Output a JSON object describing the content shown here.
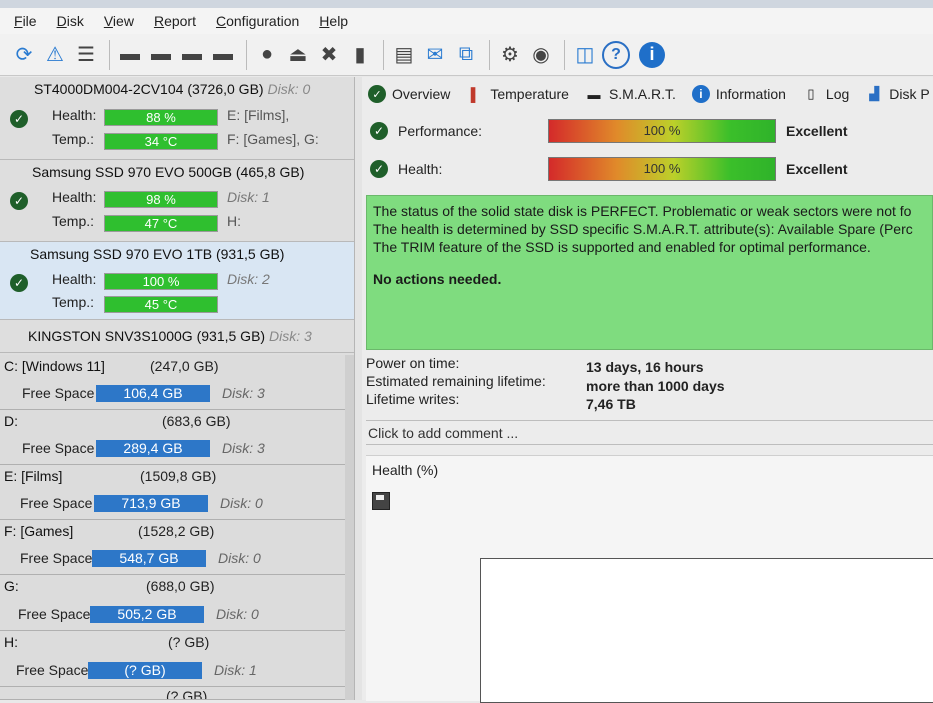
{
  "menu": [
    "File",
    "Disk",
    "View",
    "Report",
    "Configuration",
    "Help"
  ],
  "toolbar": {
    "icons": [
      "refresh-icon",
      "warning-refresh-icon",
      "list-icon",
      "hdd-icon",
      "hdd-clock-icon",
      "hdd-check-icon",
      "hdd-tool-icon",
      "disk-icon",
      "eject-icon",
      "tools-icon",
      "export-icon",
      "report-icon",
      "mail-icon",
      "network-icon",
      "settings-icon",
      "speaker-icon",
      "camera-icon",
      "help-icon",
      "info-icon"
    ],
    "help": "?",
    "info": "i"
  },
  "disks": [
    {
      "title": "ST4000DM004-2CV104",
      "size": "(3726,0 GB)",
      "disk": "Disk: 0",
      "health": "88 %",
      "temp": "34 °C",
      "side1": "E: [Films],",
      "side2": "F: [Games], G:"
    },
    {
      "title": "Samsung SSD 970 EVO 500GB",
      "size": "(465,8 GB)",
      "disk": "",
      "health": "98 %",
      "temp": "47 °C",
      "side1": "Disk: 1",
      "side2": "H:"
    },
    {
      "title": "Samsung SSD 970 EVO 1TB",
      "size": "(931,5 GB)",
      "disk": "",
      "health": "100 %",
      "temp": "45 °C",
      "side1": "Disk: 2",
      "side2": ""
    },
    {
      "title": "KINGSTON SNV3S1000G",
      "size": "(931,5 GB)",
      "disk": "Disk: 3"
    }
  ],
  "labels": {
    "health": "Health:",
    "temp": "Temp.:",
    "free": "Free Space"
  },
  "volumes": [
    {
      "name": "C: [Windows 11]",
      "size": "(247,0 GB)",
      "free": "106,4 GB",
      "disk": "Disk: 3"
    },
    {
      "name": "D:",
      "size": "(683,6 GB)",
      "free": "289,4 GB",
      "disk": "Disk: 3"
    },
    {
      "name": "E: [Films]",
      "size": "(1509,8 GB)",
      "free": "713,9 GB",
      "disk": "Disk: 0"
    },
    {
      "name": "F: [Games]",
      "size": "(1528,2 GB)",
      "free": "548,7 GB",
      "disk": "Disk: 0"
    },
    {
      "name": "G:",
      "size": "(688,0 GB)",
      "free": "505,2 GB",
      "disk": "Disk: 0"
    },
    {
      "name": "H:",
      "size": "(? GB)",
      "free": "(? GB)",
      "disk": "Disk: 1"
    },
    {
      "name": "",
      "size": "(? GB)"
    }
  ],
  "tabs": [
    "Overview",
    "Temperature",
    "S.M.A.R.T.",
    "Information",
    "Log",
    "Disk P"
  ],
  "performance": {
    "label": "Performance:",
    "value": "100 %",
    "rating": "Excellent"
  },
  "health": {
    "label": "Health:",
    "value": "100 %",
    "rating": "Excellent"
  },
  "status": {
    "line1": "The status of the solid state disk is PERFECT. Problematic or weak sectors were not fo",
    "line2": "The health is determined by SSD specific S.M.A.R.T. attribute(s):  Available Spare (Perc",
    "line3": "The TRIM feature of the SSD is supported and enabled for optimal performance.",
    "action": "No actions needed."
  },
  "info": [
    {
      "k": "Power on time:",
      "v": "13 days, 16 hours"
    },
    {
      "k": "Estimated remaining lifetime:",
      "v": "more than 1000 days"
    },
    {
      "k": "Lifetime writes:",
      "v": "7,46 TB"
    }
  ],
  "comment": "Click to add comment ...",
  "chart_title": "Health (%)"
}
